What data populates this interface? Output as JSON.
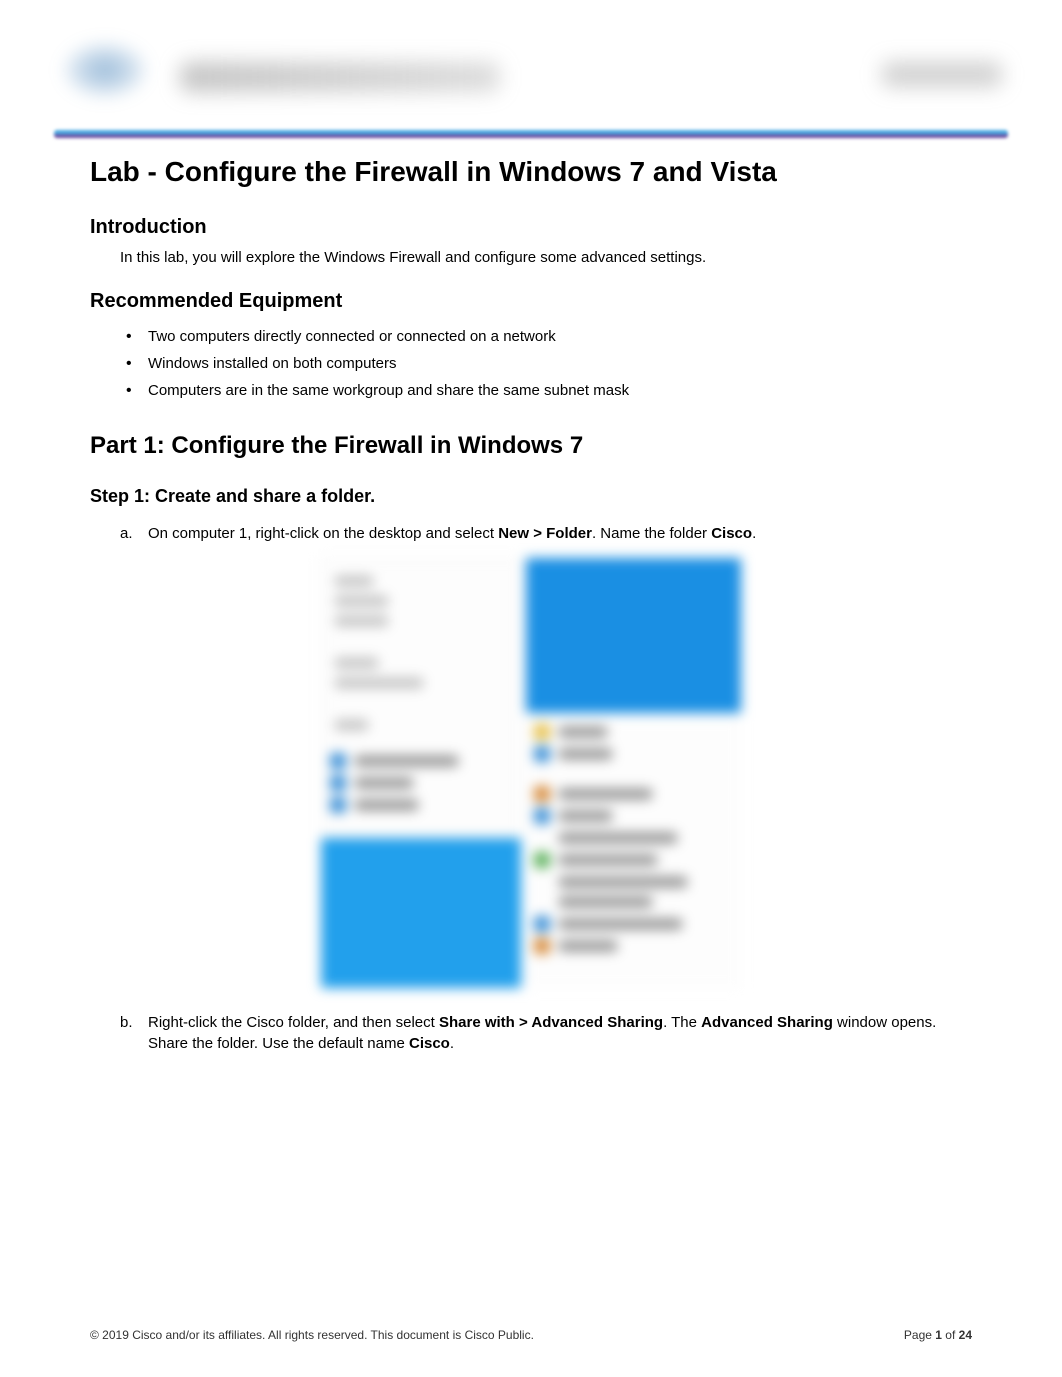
{
  "header": {
    "logo_alt": "Cisco logo",
    "academy_text": "Cisco Networking Academy",
    "right_text": "Mind Wide Open"
  },
  "title": "Lab - Configure the Firewall in Windows 7 and Vista",
  "intro": {
    "heading": "Introduction",
    "text": "In this lab, you will explore the Windows Firewall and configure some advanced settings."
  },
  "equipment": {
    "heading": "Recommended Equipment",
    "items": [
      "Two computers directly connected or connected on a network",
      "Windows installed on both computers",
      "Computers are in the same workgroup and share the same subnet mask"
    ]
  },
  "part1": {
    "heading": "Part 1: Configure the Firewall in Windows 7",
    "step1": {
      "heading": "Step 1: Create and share a folder.",
      "a": {
        "letter": "a.",
        "pre": "On computer 1, right-click on the desktop and select ",
        "bold1": "New > Folder",
        "mid": ". Name the folder ",
        "bold2": "Cisco",
        "post": "."
      },
      "b": {
        "letter": "b.",
        "pre": "Right-click the Cisco folder, and then select ",
        "bold1": "Share with > Advanced Sharing",
        "mid1": ". The ",
        "bold2": "Advanced Sharing",
        "mid2": " window opens. Share the folder. Use the default name ",
        "bold3": "Cisco",
        "post": "."
      }
    }
  },
  "footer": {
    "copyright": "© 2019 Cisco and/or its affiliates. All rights reserved. This document is Cisco Public.",
    "page_pre": "Page ",
    "page_num": "1",
    "page_mid": " of ",
    "page_total": "24"
  }
}
